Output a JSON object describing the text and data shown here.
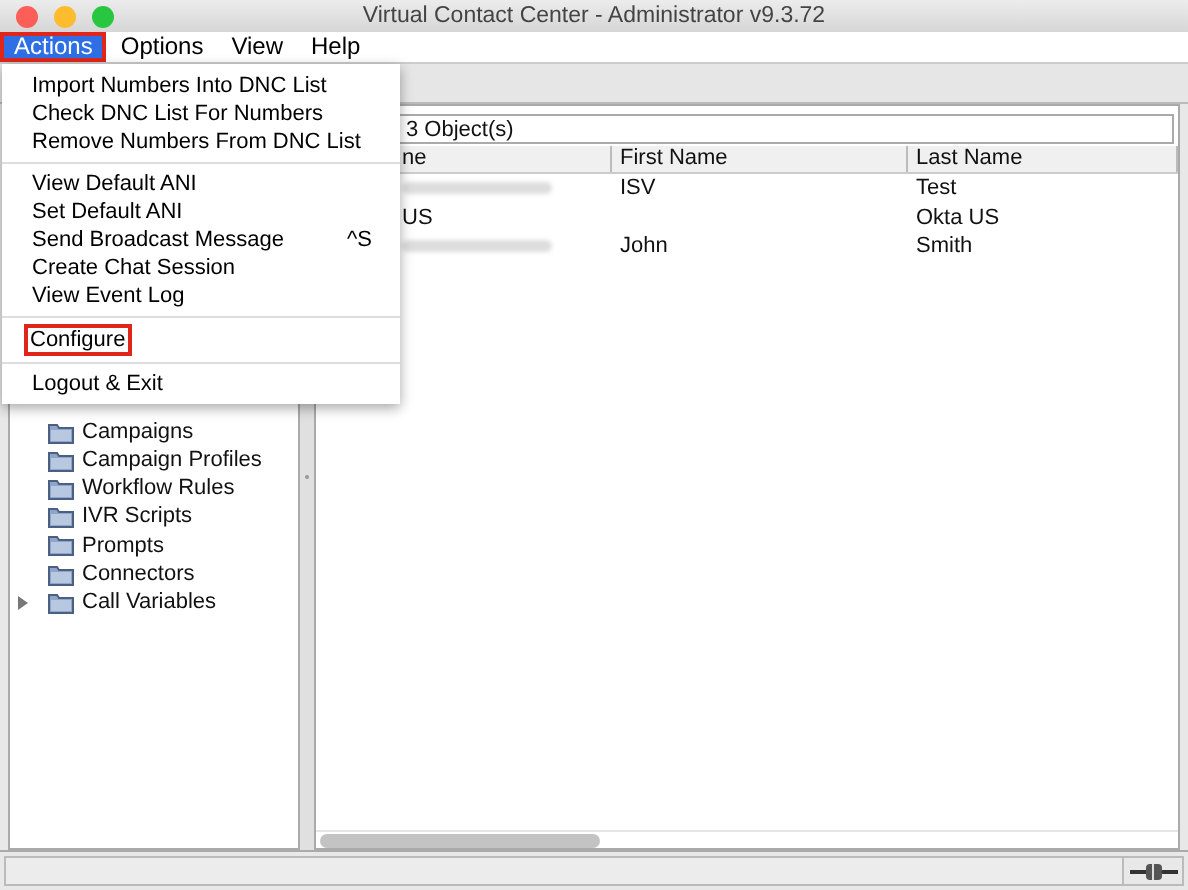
{
  "window": {
    "title": "Virtual Contact Center - Administrator v9.3.72"
  },
  "menubar": [
    {
      "label": "Actions",
      "selected": true,
      "annotated": true
    },
    {
      "label": "Options",
      "selected": false,
      "annotated": false
    },
    {
      "label": "View",
      "selected": false,
      "annotated": false
    },
    {
      "label": "Help",
      "selected": false,
      "annotated": false
    }
  ],
  "dropdown": [
    {
      "kind": "item",
      "label": "Import Numbers Into DNC List",
      "annotated": false
    },
    {
      "kind": "item",
      "label": "Check DNC List For Numbers",
      "annotated": false
    },
    {
      "kind": "item",
      "label": "Remove Numbers From DNC List",
      "annotated": false
    },
    {
      "kind": "separator"
    },
    {
      "kind": "item",
      "label": "View Default ANI",
      "annotated": false
    },
    {
      "kind": "item",
      "label": "Set Default ANI",
      "annotated": false
    },
    {
      "kind": "item",
      "label": "Send Broadcast Message",
      "shortcut": "^S",
      "annotated": false
    },
    {
      "kind": "item",
      "label": "Create Chat Session",
      "annotated": false
    },
    {
      "kind": "item",
      "label": "View Event Log",
      "annotated": false
    },
    {
      "kind": "separator"
    },
    {
      "kind": "item",
      "label": "Configure",
      "annotated": true
    },
    {
      "kind": "separator"
    },
    {
      "kind": "item",
      "label": "Logout & Exit",
      "annotated": false
    }
  ],
  "tree": [
    {
      "label": "Campaigns",
      "has_children": false
    },
    {
      "label": "Campaign Profiles",
      "has_children": false
    },
    {
      "label": "Workflow Rules",
      "has_children": false
    },
    {
      "label": "IVR Scripts",
      "has_children": false
    },
    {
      "label": "Prompts",
      "has_children": false
    },
    {
      "label": "Connectors",
      "has_children": false
    },
    {
      "label": "Call Variables",
      "has_children": true
    }
  ],
  "object_count": "3 Object(s)",
  "table": {
    "columns": [
      "ne",
      "First Name",
      "Last Name"
    ],
    "rows": [
      {
        "column_1_redacted": true,
        "first_name": "ISV",
        "last_name": "Test"
      },
      {
        "column_1": "US",
        "column_1_redacted": false,
        "last_name": "Okta US"
      },
      {
        "column_1_redacted": true,
        "first_name": "John",
        "last_name": "Smith"
      }
    ]
  }
}
